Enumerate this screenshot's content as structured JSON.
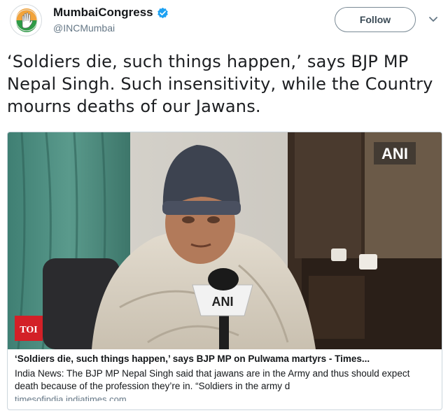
{
  "account": {
    "display_name": "MumbaiCongress",
    "handle": "@INCMumbai",
    "verified": true,
    "avatar_icon": "congress-hand-logo-icon"
  },
  "actions": {
    "follow_label": "Follow",
    "menu_icon": "chevron-down-icon"
  },
  "tweet": {
    "text": "‘Soldiers die, such things happen,’ says BJP MP Nepal Singh. Such insensitivity,  while the Country mourns deaths of our Jawans."
  },
  "card": {
    "watermark": "ANI",
    "mic_label": "ANI",
    "source_badge": "TOI",
    "title": "‘Soldiers die, such things happen,’ says BJP MP on Pulwama martyrs - Times...",
    "description": "India News: The BJP MP Nepal Singh said that jawans are in the Army and thus should expect death because of the profession they’re in. “Soldiers in the army d",
    "domain": "timesofindia.indiatimes.com"
  },
  "colors": {
    "link_blue": "#1b95e0",
    "toi_red": "#d32027",
    "verified_blue": "#1da1f2"
  }
}
